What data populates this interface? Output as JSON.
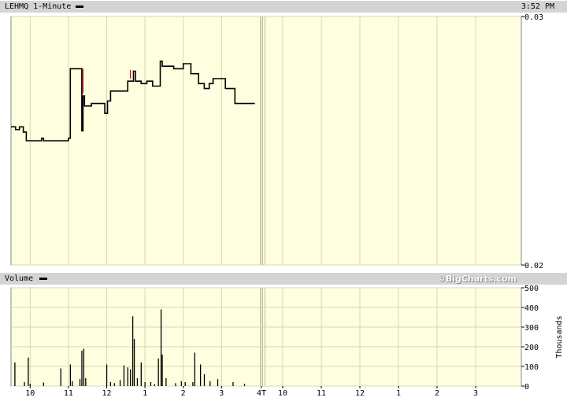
{
  "header": {
    "symbol_label": "LEHMQ 1-Minute",
    "time": "3:52 PM"
  },
  "volume_header": {
    "label": "Volume",
    "brand": "©BigCharts.com"
  },
  "colors": {
    "plot_background": "#ffffe0",
    "gridline": "#d2d8b0",
    "price_line": "#000000",
    "uptick_marker": "#cc0000",
    "header_bar": "#d4d4d4"
  },
  "chart_data": [
    {
      "type": "line",
      "title": "LEHMQ 1-Minute",
      "xlabel": "",
      "ylabel": "",
      "ylim": [
        0.02,
        0.03
      ],
      "y_ticks": [
        "0.03",
        "0.02"
      ],
      "grid": true,
      "x_ticks": [
        "10",
        "11",
        "12",
        "1",
        "2",
        "3",
        "4T",
        "10",
        "11",
        "12",
        "1",
        "2",
        "3"
      ],
      "series": [
        {
          "values": [
            [
              9.5,
              0.02556
            ],
            [
              9.62,
              0.02556
            ],
            [
              9.62,
              0.02545
            ],
            [
              9.72,
              0.02545
            ],
            [
              9.72,
              0.02556
            ],
            [
              9.82,
              0.02556
            ],
            [
              9.82,
              0.02535
            ],
            [
              9.9,
              0.02535
            ],
            [
              9.9,
              0.025
            ],
            [
              10.3,
              0.025
            ],
            [
              10.3,
              0.0251
            ],
            [
              10.35,
              0.0251
            ],
            [
              10.35,
              0.025
            ],
            [
              11.0,
              0.025
            ],
            [
              11.0,
              0.0251
            ],
            [
              11.05,
              0.0251
            ],
            [
              11.05,
              0.0279
            ],
            [
              11.35,
              0.0279
            ],
            [
              11.35,
              0.0254
            ],
            [
              11.38,
              0.0254
            ],
            [
              11.38,
              0.0268
            ],
            [
              11.42,
              0.0268
            ],
            [
              11.42,
              0.0264
            ],
            [
              11.6,
              0.0264
            ],
            [
              11.6,
              0.0265
            ],
            [
              11.95,
              0.0265
            ],
            [
              11.95,
              0.0261
            ],
            [
              12.02,
              0.0261
            ],
            [
              12.02,
              0.0266
            ],
            [
              12.1,
              0.0266
            ],
            [
              12.1,
              0.027
            ],
            [
              12.55,
              0.027
            ],
            [
              12.55,
              0.0274
            ],
            [
              12.7,
              0.0274
            ],
            [
              12.7,
              0.0278
            ],
            [
              12.75,
              0.0278
            ],
            [
              12.75,
              0.0274
            ],
            [
              12.9,
              0.0274
            ],
            [
              12.9,
              0.0273
            ],
            [
              13.05,
              0.0273
            ],
            [
              13.05,
              0.0274
            ],
            [
              13.2,
              0.0274
            ],
            [
              13.2,
              0.0272
            ],
            [
              13.4,
              0.0272
            ],
            [
              13.4,
              0.0282
            ],
            [
              13.45,
              0.0282
            ],
            [
              13.45,
              0.028
            ],
            [
              13.75,
              0.028
            ],
            [
              13.75,
              0.0279
            ],
            [
              14.0,
              0.0279
            ],
            [
              14.0,
              0.0281
            ],
            [
              14.2,
              0.0281
            ],
            [
              14.2,
              0.0277
            ],
            [
              14.4,
              0.0277
            ],
            [
              14.4,
              0.0273
            ],
            [
              14.55,
              0.0273
            ],
            [
              14.55,
              0.0271
            ],
            [
              14.68,
              0.0271
            ],
            [
              14.68,
              0.0273
            ],
            [
              14.78,
              0.0273
            ],
            [
              14.78,
              0.0275
            ],
            [
              15.1,
              0.0275
            ],
            [
              15.1,
              0.0271
            ],
            [
              15.35,
              0.0271
            ],
            [
              15.35,
              0.0265
            ],
            [
              15.87,
              0.0265
            ]
          ]
        }
      ],
      "markers": [
        {
          "x": 11.38,
          "y_from": 0.0269,
          "y_to": 0.0279
        },
        {
          "x": 12.62,
          "y_from": 0.0275,
          "y_to": 0.02785
        }
      ]
    },
    {
      "type": "bar",
      "title": "Volume",
      "xlabel": "",
      "ylabel": "Thousands",
      "ylim": [
        0,
        500
      ],
      "y_ticks": [
        "500",
        "400",
        "300",
        "200",
        "100",
        "0"
      ],
      "grid": true,
      "bars": [
        [
          9.6,
          120
        ],
        [
          9.85,
          20
        ],
        [
          9.95,
          145
        ],
        [
          10.0,
          12
        ],
        [
          10.35,
          18
        ],
        [
          10.8,
          90
        ],
        [
          11.05,
          110
        ],
        [
          11.1,
          25
        ],
        [
          11.3,
          35
        ],
        [
          11.35,
          180
        ],
        [
          11.4,
          190
        ],
        [
          11.45,
          40
        ],
        [
          12.0,
          110
        ],
        [
          12.1,
          20
        ],
        [
          12.2,
          15
        ],
        [
          12.35,
          30
        ],
        [
          12.45,
          105
        ],
        [
          12.55,
          95
        ],
        [
          12.62,
          85
        ],
        [
          12.68,
          355
        ],
        [
          12.72,
          240
        ],
        [
          12.8,
          40
        ],
        [
          12.9,
          120
        ],
        [
          13.0,
          20
        ],
        [
          13.15,
          20
        ],
        [
          13.25,
          10
        ],
        [
          13.35,
          140
        ],
        [
          13.42,
          390
        ],
        [
          13.45,
          160
        ],
        [
          13.55,
          40
        ],
        [
          13.8,
          15
        ],
        [
          13.95,
          25
        ],
        [
          14.05,
          20
        ],
        [
          14.25,
          20
        ],
        [
          14.3,
          170
        ],
        [
          14.45,
          110
        ],
        [
          14.55,
          60
        ],
        [
          14.7,
          25
        ],
        [
          14.9,
          35
        ],
        [
          15.3,
          20
        ],
        [
          15.6,
          12
        ]
      ]
    }
  ]
}
